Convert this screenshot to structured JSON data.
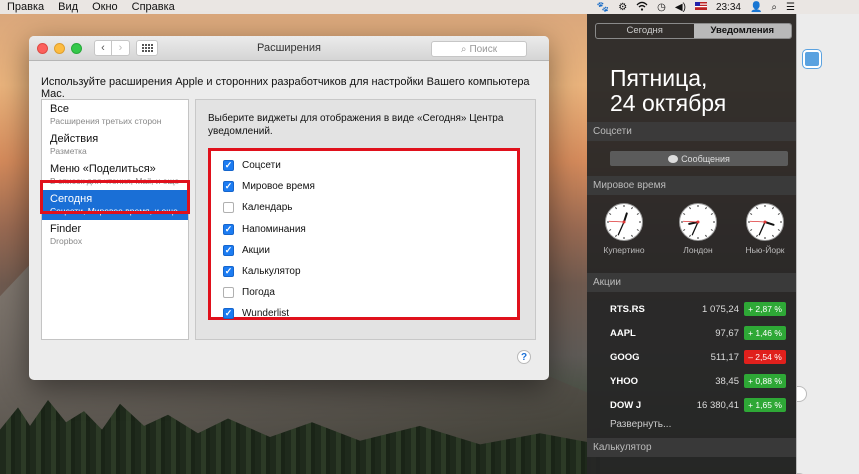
{
  "menubar": {
    "items": [
      "Правка",
      "Вид",
      "Окно",
      "Справка"
    ],
    "time": "23:34"
  },
  "window": {
    "title": "Расширения",
    "search_placeholder": "Поиск",
    "description": "Используйте расширения Apple и сторонних разработчиков для настройки Вашего компьютера Mac.",
    "sidebar": [
      {
        "title": "Все",
        "subtitle": "Расширения третьих сторон",
        "selected": false
      },
      {
        "title": "Действия",
        "subtitle": "Разметка",
        "selected": false
      },
      {
        "title": "Меню «Поделиться»",
        "subtitle": "В список для чтения, Mail, и еще 9...",
        "selected": false
      },
      {
        "title": "Сегодня",
        "subtitle": "Соцсети, Мировое время, и еще 4...",
        "selected": true
      },
      {
        "title": "Finder",
        "subtitle": "Dropbox",
        "selected": false
      }
    ],
    "panel_heading": "Выберите виджеты для отображения в виде «Сегодня» Центра уведомлений.",
    "widgets": [
      {
        "label": "Соцсети",
        "checked": true
      },
      {
        "label": "Мировое время",
        "checked": true
      },
      {
        "label": "Календарь",
        "checked": false
      },
      {
        "label": "Напоминания",
        "checked": true
      },
      {
        "label": "Акции",
        "checked": true
      },
      {
        "label": "Калькулятор",
        "checked": true
      },
      {
        "label": "Погода",
        "checked": false
      },
      {
        "label": "Wunderlist",
        "checked": true
      }
    ],
    "help": "?"
  },
  "notification_center": {
    "tabs": [
      {
        "label": "Сегодня",
        "active": false
      },
      {
        "label": "Уведомления",
        "active": true
      }
    ],
    "day_line1": "Пятница,",
    "day_line2": "24 октября",
    "sections": {
      "social": "Соцсети",
      "world_time": "Мировое время",
      "stocks": "Акции",
      "calculator": "Калькулятор"
    },
    "messages_button": "Сообщения",
    "clocks": [
      {
        "city": "Купертино",
        "hour": 12.6,
        "minute": 34
      },
      {
        "city": "Лондон",
        "hour": 8.6,
        "minute": 34
      },
      {
        "city": "Нью-Йорк",
        "hour": 3.6,
        "minute": 34
      }
    ],
    "stocks": [
      {
        "symbol": "RTS.RS",
        "value": "1 075,24",
        "change": "+ 2,87 %",
        "direction": "up"
      },
      {
        "symbol": "AAPL",
        "value": "97,67",
        "change": "+ 1,46 %",
        "direction": "up"
      },
      {
        "symbol": "GOOG",
        "value": "511,17",
        "change": "– 2,54 %",
        "direction": "down"
      },
      {
        "symbol": "YHOO",
        "value": "38,45",
        "change": "+ 0,88 %",
        "direction": "up"
      },
      {
        "symbol": "DOW J",
        "value": "16 380,41",
        "change": "+ 1,65 %",
        "direction": "up"
      }
    ],
    "expand": "Развернуть..."
  }
}
